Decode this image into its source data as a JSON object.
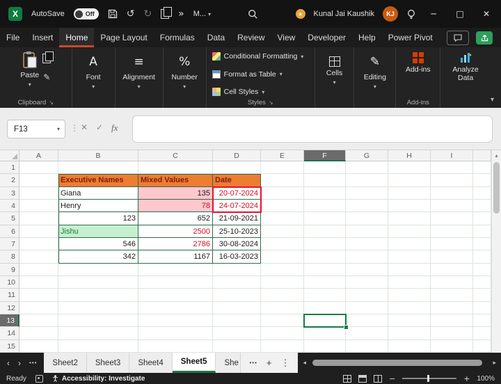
{
  "titlebar": {
    "logo_letter": "X",
    "autosave_label": "AutoSave",
    "autosave_state": "Off",
    "more_label": "M...",
    "user_name": "Kunal Jai Kaushik",
    "user_initials": "KJ"
  },
  "menubar": {
    "tabs": [
      "File",
      "Insert",
      "Home",
      "Page Layout",
      "Formulas",
      "Data",
      "Review",
      "View",
      "Developer",
      "Help",
      "Power Pivot"
    ],
    "active": "Home"
  },
  "ribbon": {
    "paste_label": "Paste",
    "clipboard_group": "Clipboard",
    "font_label": "Font",
    "alignment_label": "Alignment",
    "number_label": "Number",
    "conditional_formatting": "Conditional Formatting",
    "format_as_table": "Format as Table",
    "cell_styles": "Cell Styles",
    "styles_group": "Styles",
    "cells_label": "Cells",
    "editing_label": "Editing",
    "addins_label": "Add-ins",
    "addins_group": "Add-ins",
    "analyze_label": "Analyze Data"
  },
  "formula_bar": {
    "name_box": "F13",
    "cancel": "✕",
    "enter": "✓",
    "fx_label": "fx",
    "formula_value": ""
  },
  "sheet": {
    "column_headers": [
      "A",
      "B",
      "C",
      "D",
      "E",
      "F",
      "G",
      "H",
      "I"
    ],
    "row_headers": [
      "1",
      "2",
      "3",
      "4",
      "5",
      "6",
      "7",
      "8",
      "9",
      "10",
      "11",
      "12",
      "13",
      "14",
      "15"
    ],
    "selected_column": "F",
    "selected_row": "13",
    "selected_cell": "F13",
    "cells": [
      {
        "ref": "B2",
        "text": "Executive Names",
        "styles": [
          "header"
        ]
      },
      {
        "ref": "C2",
        "text": "Mixed Values",
        "styles": [
          "header"
        ]
      },
      {
        "ref": "D2",
        "text": "Date",
        "styles": [
          "header"
        ]
      },
      {
        "ref": "B3",
        "text": "Giana",
        "styles": []
      },
      {
        "ref": "C3",
        "text": "135",
        "styles": [
          "num",
          "bad"
        ]
      },
      {
        "ref": "D3",
        "text": "20-07-2024",
        "styles": [
          "date",
          "red"
        ]
      },
      {
        "ref": "B4",
        "text": "Henry",
        "styles": []
      },
      {
        "ref": "C4",
        "text": "78",
        "styles": [
          "num",
          "bad",
          "red"
        ]
      },
      {
        "ref": "D4",
        "text": "24-07-2024",
        "styles": [
          "date",
          "red"
        ]
      },
      {
        "ref": "B5",
        "text": "123",
        "styles": [
          "num"
        ]
      },
      {
        "ref": "C5",
        "text": "652",
        "styles": [
          "num"
        ]
      },
      {
        "ref": "D5",
        "text": "21-09-2021",
        "styles": [
          "date"
        ]
      },
      {
        "ref": "B6",
        "text": "Jishu",
        "styles": [
          "good"
        ]
      },
      {
        "ref": "C6",
        "text": "2500",
        "styles": [
          "num",
          "red"
        ]
      },
      {
        "ref": "D6",
        "text": "25-10-2023",
        "styles": [
          "date"
        ]
      },
      {
        "ref": "B7",
        "text": "546",
        "styles": [
          "num"
        ]
      },
      {
        "ref": "C7",
        "text": "2786",
        "styles": [
          "num",
          "red"
        ]
      },
      {
        "ref": "D7",
        "text": "30-08-2024",
        "styles": [
          "date"
        ]
      },
      {
        "ref": "B8",
        "text": "342",
        "styles": [
          "num"
        ]
      },
      {
        "ref": "C8",
        "text": "1167",
        "styles": [
          "num"
        ]
      },
      {
        "ref": "D8",
        "text": "16-03-2023",
        "styles": [
          "date"
        ]
      }
    ]
  },
  "sheet_tabs": {
    "tabs": [
      "Sheet2",
      "Sheet3",
      "Sheet4",
      "Sheet5",
      "She"
    ],
    "active": "Sheet5"
  },
  "status_bar": {
    "mode": "Ready",
    "accessibility": "Accessibility: Investigate",
    "zoom_level": "100%"
  },
  "colors": {
    "header_fill": "#ED7D31",
    "bad_fill": "#FFC7CE",
    "good_fill": "#C6EFCE",
    "red_text": "#d40f20",
    "selection_green": "#107C41",
    "red_box": "#e8112d",
    "active_tab_underline": "#c8492f"
  },
  "icons": {
    "undo": "↺",
    "redo": "↻",
    "more_chevron": "»",
    "caret_down": "▾",
    "minimize": "─",
    "maximize": "□",
    "close": "✕",
    "grip": "⋮",
    "tab_prev": "‹",
    "tab_next": "›",
    "ellipsis": "•••",
    "add_sheet": "+",
    "menu_dots": "⋮",
    "scroll_left": "◂",
    "scroll_right": "▸",
    "scroll_up": "▴",
    "minus": "−",
    "plus": "+",
    "star": "★",
    "font_a": "A",
    "align": "≡",
    "percent": "%",
    "pencil": "✎",
    "launcher": "↘",
    "collapse_ribbon": "▾"
  }
}
